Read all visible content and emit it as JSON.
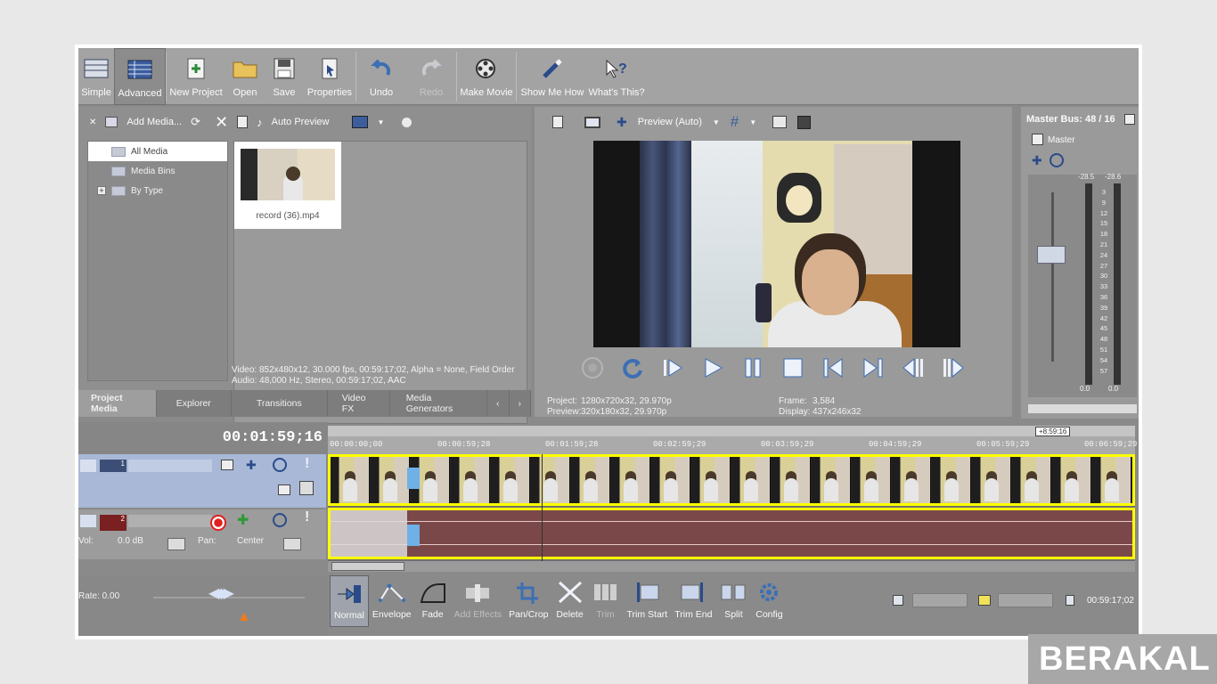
{
  "toolbar": {
    "items": [
      {
        "label": "Simple"
      },
      {
        "label": "Advanced"
      },
      {
        "label": "New Project"
      },
      {
        "label": "Open"
      },
      {
        "label": "Save"
      },
      {
        "label": "Properties"
      },
      {
        "label": "Undo"
      },
      {
        "label": "Redo"
      },
      {
        "label": "Make Movie"
      },
      {
        "label": "Show Me How"
      },
      {
        "label": "What's This?"
      }
    ]
  },
  "media": {
    "add_media_label": "Add Media...",
    "auto_preview_label": "Auto Preview",
    "tree": [
      "All Media",
      "Media Bins",
      "By Type"
    ],
    "tree_expander": "+",
    "file_name": "record (36).mp4",
    "info_video": "Video: 852x480x12, 30.000 fps, 00:59:17;02, Alpha = None, Field Order",
    "info_audio": "Audio: 48,000 Hz, Stereo, 00:59:17;02, AAC",
    "tabs": [
      "Project Media",
      "Explorer",
      "Transitions",
      "Video FX",
      "Media Generators"
    ],
    "tab_prev": "‹",
    "tab_next": "›"
  },
  "preview": {
    "mode_label": "Preview (Auto)",
    "project_label": "Project:",
    "project_value": "1280x720x32, 29.970p",
    "preview_label": "Preview:",
    "preview_value": "320x180x32, 29.970p",
    "frame_label": "Frame:",
    "frame_value": "3,584",
    "display_label": "Display:",
    "display_value": "437x246x32"
  },
  "master": {
    "title": "Master Bus: 48 / 16",
    "label": "Master",
    "peak_left": "-28.5",
    "peak_right": "-28.6",
    "scale": [
      "3",
      "9",
      "12",
      "15",
      "18",
      "21",
      "24",
      "27",
      "30",
      "33",
      "36",
      "39",
      "42",
      "45",
      "48",
      "51",
      "54",
      "57"
    ],
    "bottom_left": "0.0",
    "bottom_right": "0.0"
  },
  "timeline": {
    "timecode": "00:01:59;16",
    "ruler_marks": [
      "00:00:00;00",
      "00:00:59;28",
      "00:01:59;28",
      "00:02:59;29",
      "00:03:59;29",
      "00:04:59;29",
      "00:05:59;29",
      "00:06:59;29"
    ],
    "marker_label": "+8:59:16",
    "video_track_number": "1",
    "audio_track_number": "2",
    "vol_label": "Vol:",
    "vol_value": "0.0 dB",
    "pan_label": "Pan:",
    "pan_value": "Center"
  },
  "bottom": {
    "rate_label": "Rate: 0.00",
    "tools": [
      {
        "label": "Normal"
      },
      {
        "label": "Envelope"
      },
      {
        "label": "Fade"
      },
      {
        "label": "Add Effects"
      },
      {
        "label": "Pan/Crop"
      },
      {
        "label": "Delete"
      },
      {
        "label": "Trim"
      },
      {
        "label": "Trim Start"
      },
      {
        "label": "Trim End"
      },
      {
        "label": "Split"
      },
      {
        "label": "Config"
      }
    ],
    "end_time": "00:59:17;02"
  },
  "watermark": "BERAKAL",
  "colors": {
    "selection_yellow": "#ffff00",
    "audio_clip": "#7a4848",
    "video_track_header": "#a8b8d6",
    "record_red": "#e02020"
  }
}
